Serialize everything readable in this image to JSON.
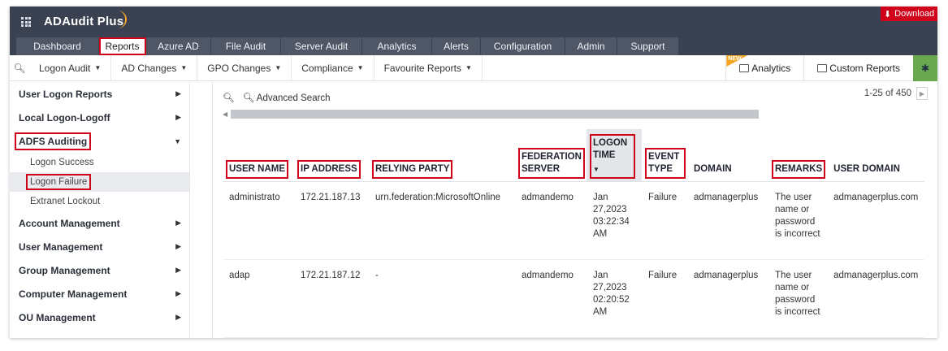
{
  "app": {
    "name": "ADAudit Plus",
    "download_label": "Download"
  },
  "tabs": [
    {
      "label": "Dashboard"
    },
    {
      "label": "Reports"
    },
    {
      "label": "Azure AD"
    },
    {
      "label": "File Audit"
    },
    {
      "label": "Server Audit"
    },
    {
      "label": "Analytics"
    },
    {
      "label": "Alerts"
    },
    {
      "label": "Configuration"
    },
    {
      "label": "Admin"
    },
    {
      "label": "Support"
    }
  ],
  "subbar": {
    "items": [
      {
        "label": "Logon Audit"
      },
      {
        "label": "AD Changes"
      },
      {
        "label": "GPO Changes"
      },
      {
        "label": "Compliance"
      },
      {
        "label": "Favourite Reports"
      }
    ],
    "new_badge": "NEW",
    "analytics_label": "Analytics",
    "custom_reports_label": "Custom Reports"
  },
  "sidebar": {
    "items": [
      {
        "label": "User Logon Reports"
      },
      {
        "label": "Local Logon-Logoff"
      },
      {
        "label": "ADFS Auditing"
      },
      {
        "label": "Logon Success"
      },
      {
        "label": "Logon Failure"
      },
      {
        "label": "Extranet Lockout"
      },
      {
        "label": "Account Management"
      },
      {
        "label": "User Management"
      },
      {
        "label": "Group Management"
      },
      {
        "label": "Computer Management"
      },
      {
        "label": "OU Management"
      }
    ]
  },
  "content": {
    "advanced_search_label": "Advanced Search",
    "pager_text": "1-25 of 450",
    "columns": [
      {
        "label": "USER NAME"
      },
      {
        "label": "IP ADDRESS"
      },
      {
        "label": "RELYING PARTY"
      },
      {
        "label": "FEDERATION SERVER"
      },
      {
        "label": "LOGON TIME"
      },
      {
        "label": "EVENT TYPE"
      },
      {
        "label": "DOMAIN"
      },
      {
        "label": "REMARKS"
      },
      {
        "label": "USER DOMAIN"
      }
    ],
    "rows": [
      {
        "user_name": "administrato",
        "ip_address": "172.21.187.13",
        "relying_party": "urn.federation:MicrosoftOnline",
        "federation_server": "admandemo",
        "logon_time": "Jan 27,2023 03:22:34 AM",
        "event_type": "Failure",
        "domain": "admanagerplus",
        "remarks": "The user name or password is incorrect",
        "user_domain": "admanagerplus.com"
      },
      {
        "user_name": "adap",
        "ip_address": "172.21.187.12",
        "relying_party": "-",
        "federation_server": "admandemo",
        "logon_time": "Jan 27,2023 02:20:52 AM",
        "event_type": "Failure",
        "domain": "admanagerplus",
        "remarks": "The user name or password is incorrect",
        "user_domain": "admanagerplus.com"
      }
    ]
  }
}
